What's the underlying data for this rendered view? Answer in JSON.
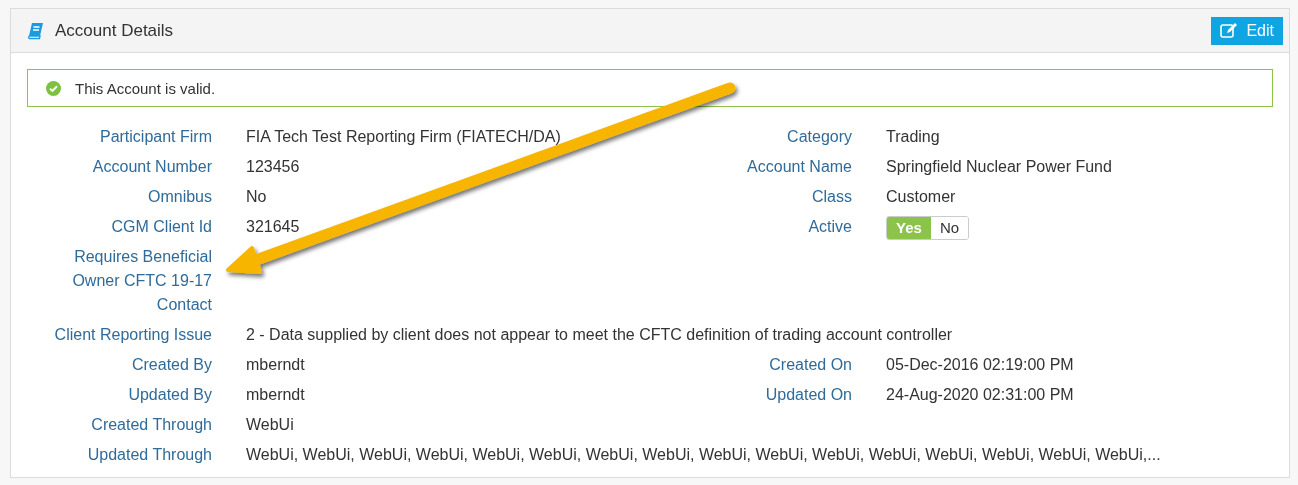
{
  "panel": {
    "title": "Account Details",
    "edit_button": "Edit"
  },
  "alert": {
    "text": "This Account is valid."
  },
  "rows": [
    {
      "left": {
        "kind": "text",
        "label": "Participant Firm",
        "value": "FIA Tech Test Reporting Firm (FIATECH/DA)"
      },
      "right": {
        "kind": "text",
        "label": "Category",
        "value": "Trading"
      }
    },
    {
      "left": {
        "kind": "text",
        "label": "Account Number",
        "value": "123456"
      },
      "right": {
        "kind": "text",
        "label": "Account Name",
        "value": "Springfield Nuclear Power Fund"
      }
    },
    {
      "left": {
        "kind": "text",
        "label": "Omnibus",
        "value": "No"
      },
      "right": {
        "kind": "text",
        "label": "Class",
        "value": "Customer"
      }
    },
    {
      "left": {
        "kind": "text",
        "label": "CGM Client Id",
        "value": "321645"
      },
      "right": {
        "kind": "toggle",
        "label": "Active",
        "options": [
          {
            "label": "Yes",
            "selected": true
          },
          {
            "label": "No",
            "selected": false
          }
        ]
      }
    },
    {
      "left": {
        "kind": "text",
        "label": "Requires Beneficial Owner CFTC 19-17 Contact"
      }
    },
    {
      "left": {
        "kind": "wide",
        "label": "Client Reporting Issue",
        "value": "2 - Data supplied by client does not appear to meet the CFTC definition of trading account controller"
      }
    },
    {
      "left": {
        "kind": "text",
        "label": "Created By",
        "value": "mberndt"
      },
      "right": {
        "kind": "text",
        "label": "Created On",
        "value": "05-Dec-2016 02:19:00 PM"
      }
    },
    {
      "left": {
        "kind": "text",
        "label": "Updated By",
        "value": "mberndt"
      },
      "right": {
        "kind": "text",
        "label": "Updated On",
        "value": "24-Aug-2020 02:31:00 PM"
      }
    },
    {
      "left": {
        "kind": "text",
        "label": "Created Through",
        "value": "WebUi"
      }
    },
    {
      "left": {
        "kind": "wide",
        "label": "Updated Through",
        "value": "WebUi, WebUi, WebUi, WebUi, WebUi, WebUi, WebUi, WebUi, WebUi, WebUi, WebUi, WebUi, WebUi, WebUi, WebUi, WebUi,..."
      }
    }
  ]
}
